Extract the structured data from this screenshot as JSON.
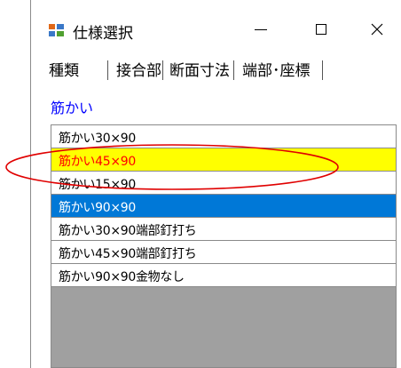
{
  "window": {
    "title": "仕様選択"
  },
  "tabs": [
    {
      "label": "種類"
    },
    {
      "label": "接合部"
    },
    {
      "label": "断面寸法"
    },
    {
      "label": "端部･座標"
    }
  ],
  "section": {
    "label": "筋かい"
  },
  "list": {
    "items": [
      {
        "label": "筋かい30×90"
      },
      {
        "label": "筋かい45×90"
      },
      {
        "label": "筋かい15×90"
      },
      {
        "label": "筋かい90×90"
      },
      {
        "label": "筋かい30×90端部釘打ち"
      },
      {
        "label": "筋かい45×90端部釘打ち"
      },
      {
        "label": "筋かい90×90金物なし"
      }
    ],
    "highlighted_index": 1,
    "selected_index": 3
  },
  "colors": {
    "highlight_bg": "#ffff00",
    "highlight_text": "#ff0000",
    "selected_bg": "#0078d7",
    "callout": "#e00000",
    "section_label": "#0000ff"
  },
  "icons": {
    "app": "app-icon",
    "minimize": "minimize-icon",
    "maximize": "maximize-icon",
    "close": "close-icon"
  }
}
